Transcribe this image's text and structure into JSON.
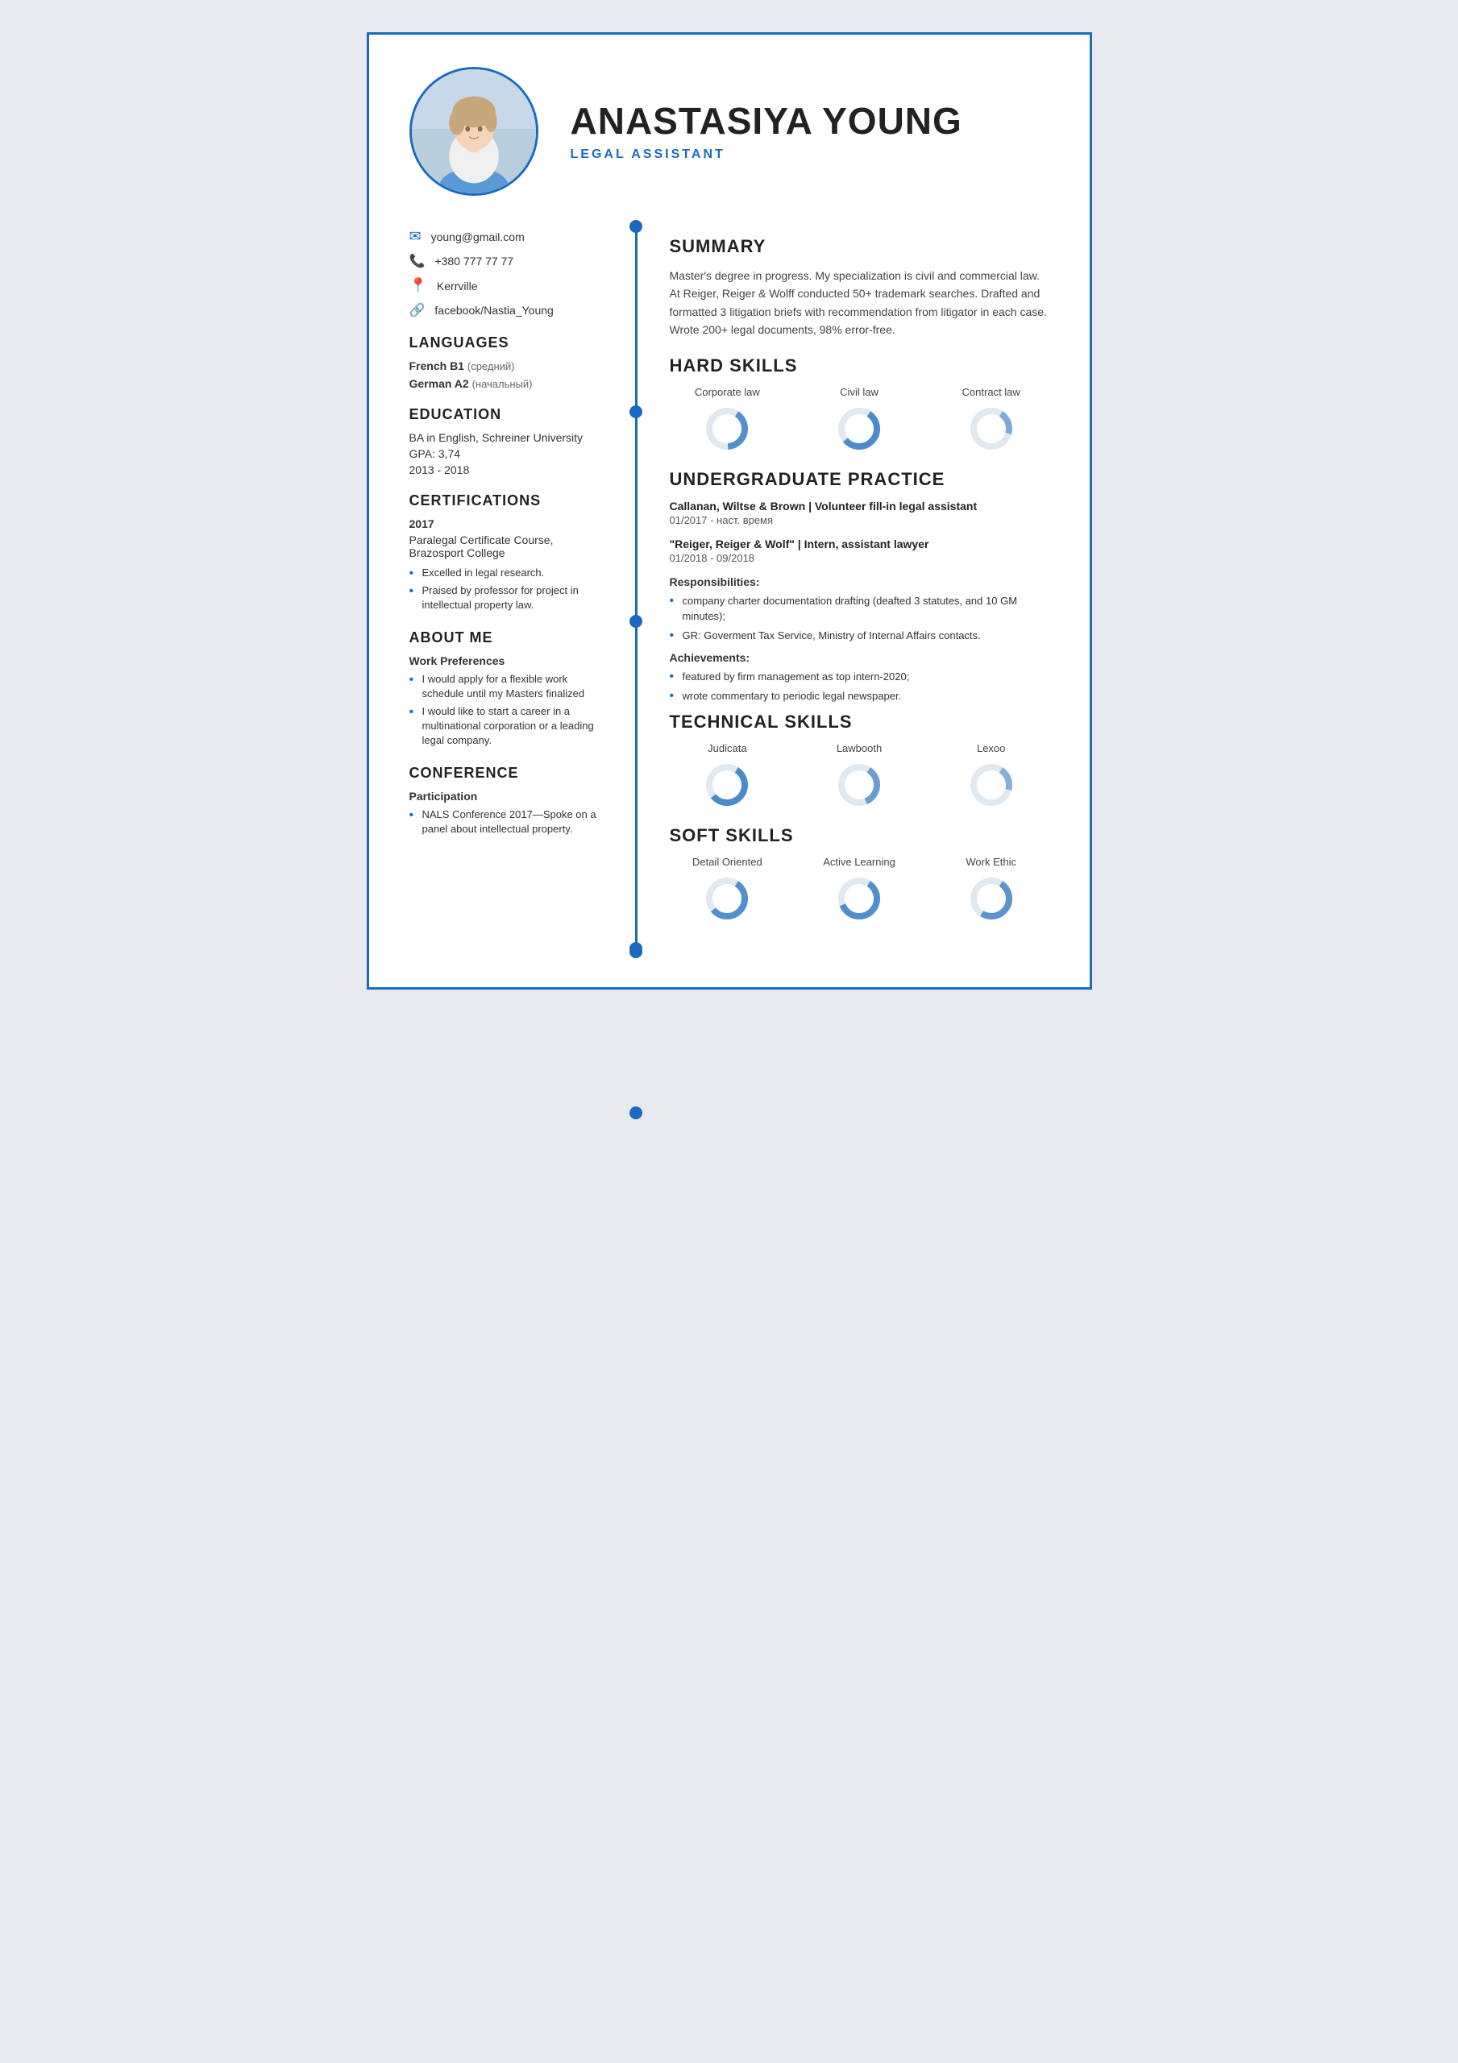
{
  "name": "ANASTASIYA YOUNG",
  "title": "LEGAL ASSISTANT",
  "contact": {
    "email": "young@gmail.com",
    "phone": "+380 777 77 77",
    "location": "Kerrville",
    "social": "facebook/Nastia_Young"
  },
  "languages": {
    "label": "LANGUAGES",
    "items": [
      {
        "name": "French B1",
        "level": "(средний)"
      },
      {
        "name": "German A2",
        "level": "(начальный)"
      }
    ]
  },
  "education": {
    "label": "EDUCATION",
    "degree": "BA in English, Schreiner University",
    "gpa": "GPA: 3,74",
    "years": "2013 - 2018"
  },
  "certifications": {
    "label": "CERTIFICATIONS",
    "year": "2017",
    "name": "Paralegal Certificate Course, Brazosport College",
    "bullets": [
      "Excelled in legal research.",
      "Praised by professor for project in intellectual property law."
    ]
  },
  "about": {
    "label": "ABOUT ME",
    "work_pref_title": "Work Preferences",
    "bullets": [
      "I would apply for a flexible work schedule until my Masters finalized",
      "I would like to start a career in a multinational corporation or a leading legal company."
    ]
  },
  "conference": {
    "label": "CONFERENCE",
    "part_title": "Participation",
    "bullets": [
      "NALS Conference 2017—Spoke on a panel about intellectual property."
    ]
  },
  "summary": {
    "label": "SUMMARY",
    "text": "Master's degree in progress. My specialization is civil and commercial law. At Reiger, Reiger & Wolff conducted 50+ trademark searches. Drafted and formatted 3 litigation briefs with recommendation from litigator in each case. Wrote 200+ legal documents, 98% error-free."
  },
  "hard_skills": {
    "label": "HARD SKILLS",
    "items": [
      {
        "name": "Corporate law",
        "pct": 40
      },
      {
        "name": "Civil law",
        "pct": 55
      },
      {
        "name": "Contract law",
        "pct": 20
      }
    ]
  },
  "undergrad": {
    "label": "UNDERGRADUATE PRACTICE",
    "positions": [
      {
        "org": "Callanan, Wiltse & Brown | Volunteer fill-in legal assistant",
        "date": "01/2017 - наст. время",
        "resp_title": "",
        "resp_bullets": [],
        "ach_title": "",
        "ach_bullets": []
      },
      {
        "org": "\"Reiger, Reiger & Wolf\" | Intern, assistant lawyer",
        "date": "01/2018 - 09/2018",
        "resp_title": "Responsibilities:",
        "resp_bullets": [
          "company charter documentation drafting (deafted 3 statutes, and 10 GM minutes);",
          "GR: Goverment Tax Service, Ministry of Internal Affairs contacts."
        ],
        "ach_title": "Achievements:",
        "ach_bullets": [
          "featured by firm management as top intern-2020;",
          "wrote commentary to periodic legal newspaper."
        ]
      }
    ]
  },
  "tech_skills": {
    "label": "TECHNICAL SKILLS",
    "items": [
      {
        "name": "Judicata",
        "pct": 55
      },
      {
        "name": "Lawbooth",
        "pct": 35
      },
      {
        "name": "Lexoo",
        "pct": 20
      }
    ]
  },
  "soft_skills": {
    "label": "SOFT SKILLS",
    "items": [
      {
        "name": "Detail Oriented",
        "pct": 55
      },
      {
        "name": "Active Learning",
        "pct": 60
      },
      {
        "name": "Work Ethic",
        "pct": 50
      }
    ]
  }
}
